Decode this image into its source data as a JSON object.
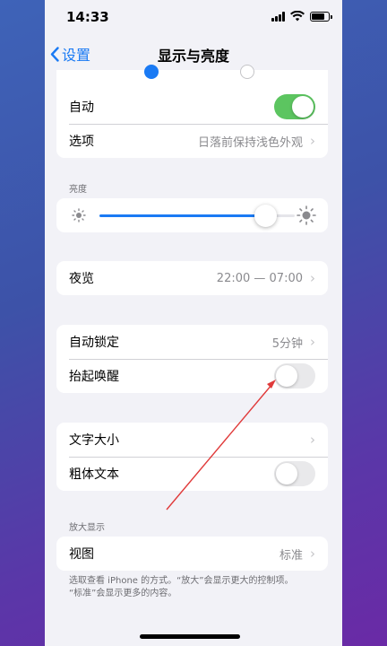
{
  "status_bar": {
    "time": "14:33"
  },
  "nav": {
    "back_label": "设置",
    "title": "显示与亮度"
  },
  "appearance": {
    "auto_label": "自动",
    "auto_on": true,
    "options_label": "选项",
    "options_value": "日落前保持浅色外观"
  },
  "brightness": {
    "section_label": "亮度",
    "level_percent": 85
  },
  "night_shift": {
    "label": "夜览",
    "value": "22:00 — 07:00"
  },
  "lock": {
    "auto_lock_label": "自动锁定",
    "auto_lock_value": "5分钟",
    "raise_to_wake_label": "抬起唤醒",
    "raise_to_wake_on": false
  },
  "text": {
    "text_size_label": "文字大小",
    "bold_text_label": "粗体文本",
    "bold_text_on": false
  },
  "zoom": {
    "section_label": "放大显示",
    "view_label": "视图",
    "view_value": "标准",
    "footnote_line1": "选取查看 iPhone 的方式。“放大”会显示更大的控制项。",
    "footnote_line2": "“标准”会显示更多的内容。"
  },
  "colors": {
    "accent": "#1a7af4",
    "toggle_on": "#5cc560",
    "annotation": "#e03a3a"
  },
  "icons": [
    "chevron-left-icon",
    "sun-small-icon",
    "sun-large-icon",
    "chevron-right-icon",
    "signal-icon",
    "wifi-icon",
    "battery-icon"
  ]
}
